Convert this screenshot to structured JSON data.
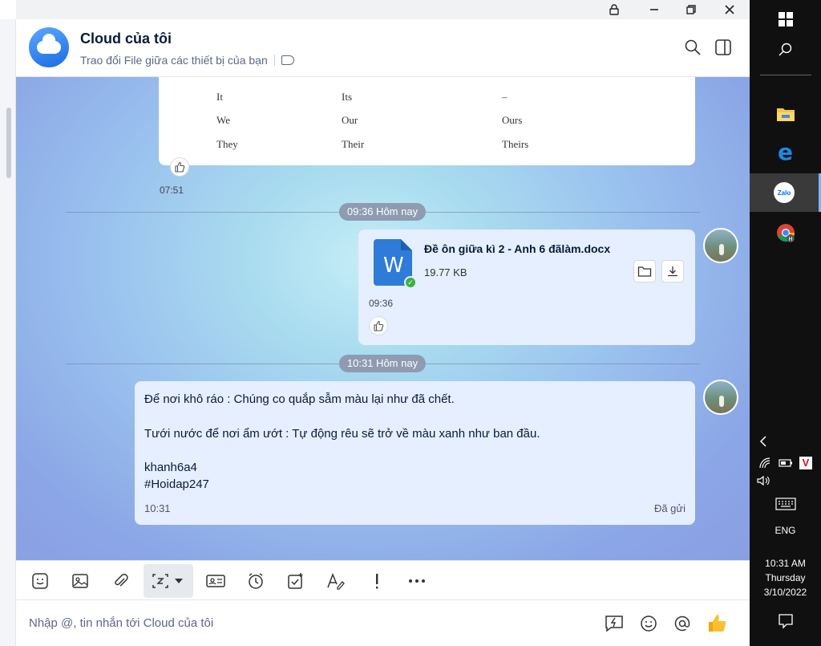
{
  "header": {
    "title": "Cloud của tôi",
    "subtitle": "Trao đổi File giữa các thiết bị của bạn"
  },
  "grammar_table": {
    "rows": [
      [
        "It",
        "Its",
        "–"
      ],
      [
        "We",
        "Our",
        "Ours"
      ],
      [
        "They",
        "Their",
        "Theirs"
      ]
    ],
    "time": "07:51"
  },
  "dividers": {
    "first": "09:36 Hôm nay",
    "second": "10:31 Hôm nay"
  },
  "file_message": {
    "file_name": "Đề ôn giữa kì 2 - Anh 6 đãlàm.docx",
    "file_size": "19.77 KB",
    "icon_letter": "W",
    "time": "09:36"
  },
  "text_message": {
    "lines": [
      "Để nơi khô ráo : Chúng co quắp sẫm màu lại như đã chết.",
      "Tưới nước để nơi ẩm ướt : Tự động rêu sẽ trở về màu xanh như ban đầu.",
      "khanh6a4",
      "#Hoidap247"
    ],
    "time": "10:31",
    "status": "Đã gửi"
  },
  "input": {
    "placeholder": "Nhập @, tin nhắn tới Cloud của tôi"
  },
  "taskbar": {
    "zalo_label": "Zalo",
    "language": "ENG",
    "time": "10:31 AM",
    "day": "Thursday",
    "date": "3/10/2022"
  },
  "colors": {
    "accent": "#1b6be0",
    "message_bg": "#e5efff",
    "pill_bg": "#8e9bb0"
  }
}
